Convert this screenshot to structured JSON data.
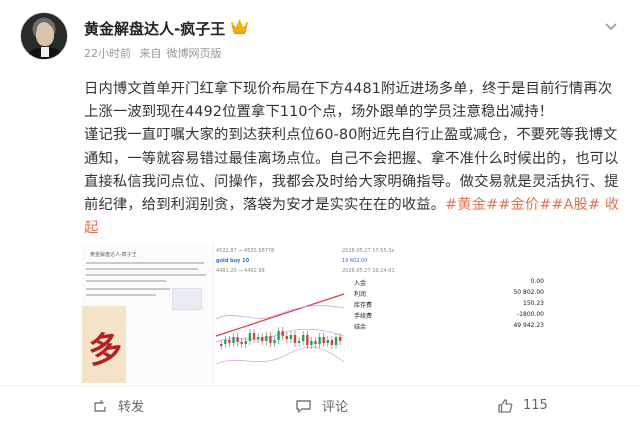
{
  "post": {
    "author": "黄金解盘达人-疯子王",
    "badge_icon": "crown-icon",
    "time": "22小时前",
    "source_prefix": "来自",
    "source": "微博网页版",
    "paragraph1": "日内博文首单开门红拿下现价布局在下方4481附近进场多单，终于是目前行情再次上涨一波到现在4492位置拿下110个点，场外跟单的学员注意稳出减持！",
    "paragraph2_text": "谨记我一直叮嘱大家的到达获利点位60-80附近先自行止盈或减仓，不要死等我博文通知，一等就容易错过最佳离场点位。自己不会把握、拿不准什么时候出的，也可以直接私信我问点位、问操作，我都会及时给大家明确指导。做交易就是灵活执行、提前纪律，给到利润别贪，落袋为安才是实实在在的收益。",
    "tags": [
      "#黄金#",
      "#金价#",
      "#A股#"
    ],
    "fold_label": "收起"
  },
  "media": {
    "left_title": "黄金解盘达人-疯子王",
    "seal_char": "多",
    "orders": [
      "4522.87 → 4535.58778",
      "4481.20 → 4492.99",
      "gold buy 10"
    ],
    "order_times": [
      "2026.05.27 17:55:3x",
      "2026.05.27 16:24:01"
    ],
    "order_profit": "19 602.00",
    "account": [
      {
        "label": "入金",
        "value": "0.00"
      },
      {
        "label": "利润",
        "value": "50 802.00"
      },
      {
        "label": "库存费",
        "value": "150.23"
      },
      {
        "label": "手续费",
        "value": "-1800.00"
      },
      {
        "label": "结余",
        "value": "49 942.23"
      }
    ]
  },
  "actions": {
    "share_label": "转发",
    "comment_label": "评论",
    "like_count": "115"
  },
  "colors": {
    "accent": "#eb7350",
    "meta": "#999999",
    "text": "#333333"
  }
}
